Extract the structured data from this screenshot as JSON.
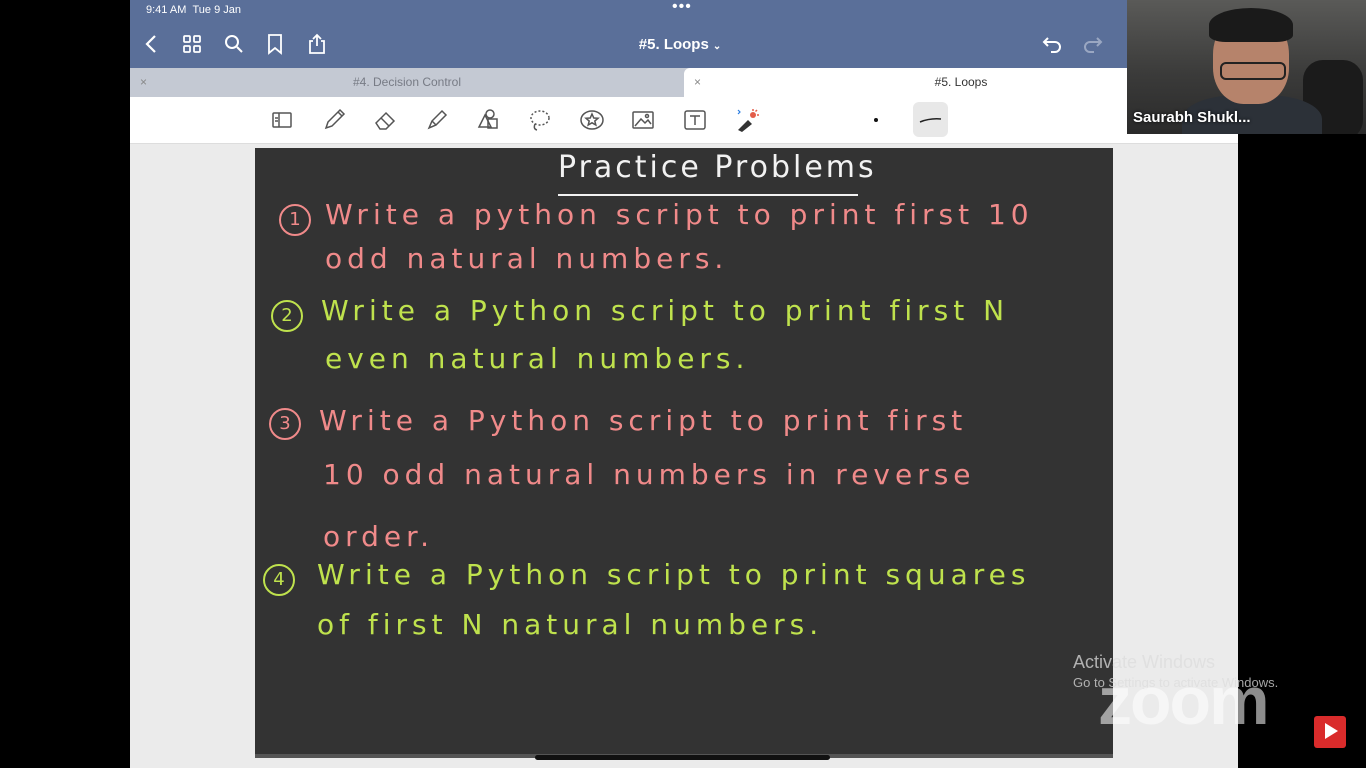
{
  "status": {
    "time": "9:41 AM",
    "date": "Tue 9 Jan",
    "dots": "•••"
  },
  "nav": {
    "icons": [
      "back-icon",
      "grid-icon",
      "search-icon",
      "bookmark-icon",
      "share-icon",
      "undo-icon",
      "redo-icon"
    ]
  },
  "document": {
    "title": "#5. Loops",
    "chevron": "⌄"
  },
  "tabs": [
    {
      "label": "#4. Decision Control",
      "close": "×"
    },
    {
      "label": "#5. Loops",
      "close": "×"
    }
  ],
  "toolbar": {
    "tools": [
      "page-icon",
      "pen-icon",
      "eraser-icon",
      "highlighter-icon",
      "shapes-icon",
      "lasso-icon",
      "sticker-icon",
      "image-icon",
      "text-icon",
      "laser-pointer-icon"
    ]
  },
  "note": {
    "heading": "Practice Problems",
    "problems": [
      {
        "num": "1",
        "lines": [
          "Write a python script to print first 10",
          "odd natural numbers."
        ],
        "color": "#f08a8a"
      },
      {
        "num": "2",
        "lines": [
          "Write a Python script to print first N",
          "even natural numbers."
        ],
        "color": "#bfe24d"
      },
      {
        "num": "3",
        "lines": [
          "Write a Python script to print first",
          "10 odd natural numbers in reverse",
          "order."
        ],
        "color": "#f08a8a"
      },
      {
        "num": "4",
        "lines": [
          "Write a Python script to print squares",
          "of first N natural numbers."
        ],
        "color": "#bfe24d"
      }
    ]
  },
  "webcam": {
    "name": "Saurabh Shukl..."
  },
  "overlay": {
    "activate_title": "Activate Windows",
    "activate_sub": "Go to Settings to activate Windows.",
    "logo": "zoom"
  },
  "colors": {
    "topbar": "#5a6f99",
    "pink_ink": "#f08a8a",
    "green_ink": "#bfe24d",
    "page": "#333333"
  }
}
